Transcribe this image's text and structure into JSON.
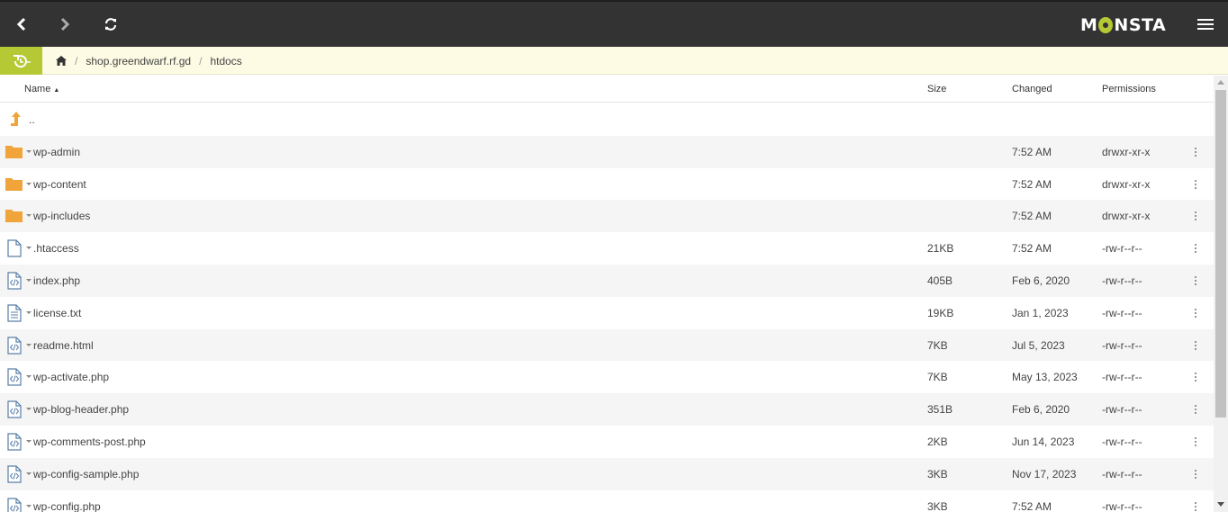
{
  "app": {
    "logo_text_left": "M",
    "logo_text_right": "NSTA"
  },
  "breadcrumb": {
    "items": [
      "shop.greendwarf.rf.gd",
      "htdocs"
    ]
  },
  "table": {
    "headers": {
      "name": "Name",
      "size": "Size",
      "changed": "Changed",
      "permissions": "Permissions"
    },
    "parent_label": "..",
    "rows": [
      {
        "name": "wp-admin",
        "type": "folder",
        "size": "",
        "changed": "7:52 AM",
        "permissions": "drwxr-xr-x"
      },
      {
        "name": "wp-content",
        "type": "folder",
        "size": "",
        "changed": "7:52 AM",
        "permissions": "drwxr-xr-x"
      },
      {
        "name": "wp-includes",
        "type": "folder",
        "size": "",
        "changed": "7:52 AM",
        "permissions": "drwxr-xr-x"
      },
      {
        "name": ".htaccess",
        "type": "file",
        "size": "21KB",
        "changed": "7:52 AM",
        "permissions": "-rw-r--r--"
      },
      {
        "name": "index.php",
        "type": "code",
        "size": "405B",
        "changed": "Feb 6, 2020",
        "permissions": "-rw-r--r--"
      },
      {
        "name": "license.txt",
        "type": "text",
        "size": "19KB",
        "changed": "Jan 1, 2023",
        "permissions": "-rw-r--r--"
      },
      {
        "name": "readme.html",
        "type": "code",
        "size": "7KB",
        "changed": "Jul 5, 2023",
        "permissions": "-rw-r--r--"
      },
      {
        "name": "wp-activate.php",
        "type": "code",
        "size": "7KB",
        "changed": "May 13, 2023",
        "permissions": "-rw-r--r--"
      },
      {
        "name": "wp-blog-header.php",
        "type": "code",
        "size": "351B",
        "changed": "Feb 6, 2020",
        "permissions": "-rw-r--r--"
      },
      {
        "name": "wp-comments-post.php",
        "type": "code",
        "size": "2KB",
        "changed": "Jun 14, 2023",
        "permissions": "-rw-r--r--"
      },
      {
        "name": "wp-config-sample.php",
        "type": "code",
        "size": "3KB",
        "changed": "Nov 17, 2023",
        "permissions": "-rw-r--r--"
      },
      {
        "name": "wp-config.php",
        "type": "code",
        "size": "3KB",
        "changed": "7:52 AM",
        "permissions": "-rw-r--r--"
      }
    ]
  },
  "colors": {
    "topbar": "#333333",
    "accent": "#b5c935",
    "breadcrumb_bg": "#fdfbe3",
    "folder": "#f0a43a",
    "file_icon": "#5a7fa8"
  }
}
